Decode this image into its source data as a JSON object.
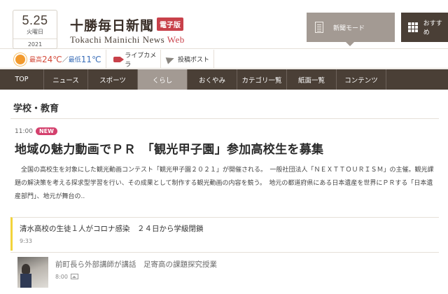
{
  "date": {
    "md": "5.25",
    "weekday": "火曜日",
    "year": "2021"
  },
  "logo": {
    "jp": "十勝毎日新聞",
    "badge": "電子版",
    "en_main": "Tokachi Mainichi News ",
    "en_web": "Web"
  },
  "header_buttons": {
    "mode": "新聞モード",
    "recommend": "おすすめ"
  },
  "weather": {
    "high_label": "最高",
    "high_value": "24℃",
    "sep": "／",
    "low_label": "最低",
    "low_value": "11℃",
    "live_camera": "ライブカメラ",
    "post": "投稿ポスト",
    "colors": {
      "high": "#d34a3a",
      "low": "#3b6fb8"
    }
  },
  "nav": {
    "items": [
      {
        "label": "TOP"
      },
      {
        "label": "ニュース"
      },
      {
        "label": "スポーツ"
      },
      {
        "label": "くらし"
      },
      {
        "label": "おくやみ"
      },
      {
        "label": "カテゴリ一覧"
      },
      {
        "label": "紙面一覧"
      },
      {
        "label": "コンテンツ"
      }
    ],
    "active": "くらし"
  },
  "section": {
    "title": "学校・教育"
  },
  "lead": {
    "time": "11:00",
    "badge": "NEW",
    "title": "地域の魅力動画でＰＲ　「観光甲子園」参加高校生を募集",
    "body": "全国の高校生を対象にした観光動画コンテスト「観光甲子園２０２１」が開催される。　一般社団法人「ＮＥＸＴＴＯＵＲＩＳＭ」の主催。観光課題の解決策を考える探求型学習を行い、その成果として制作する観光動画の内容を競う。　地元の都道府県にある日本遺産を世界にＰＲする「日本遺産部門」、地元が舞台の.."
  },
  "articles": [
    {
      "title": "清水高校の生徒１人がコロナ感染　２４日から学級閉鎖",
      "time": "9:33"
    },
    {
      "title": "前町長ら外部講師が講話　足寄高の課題探究授業",
      "time": "8:00"
    }
  ],
  "colors": {
    "nav_bg": "#4a3f36",
    "active_bg": "#a39a93",
    "accent": "#c8414a",
    "new_badge": "#d4406d",
    "marker": "#f2d33b"
  }
}
